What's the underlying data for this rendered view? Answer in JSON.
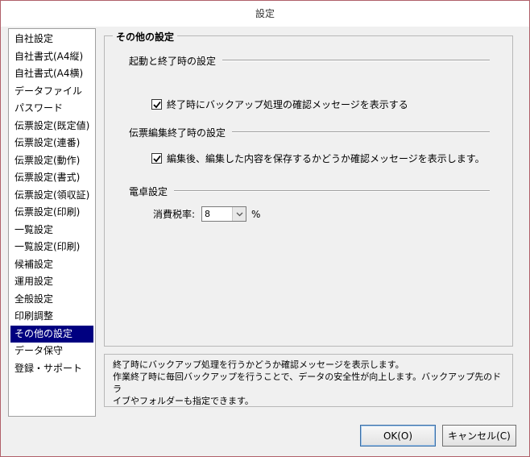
{
  "window": {
    "title": "設定"
  },
  "sidebar": {
    "items": [
      {
        "label": "自社設定",
        "selected": false
      },
      {
        "label": "自社書式(A4縦)",
        "selected": false
      },
      {
        "label": "自社書式(A4横)",
        "selected": false
      },
      {
        "label": "データファイル",
        "selected": false
      },
      {
        "label": "パスワード",
        "selected": false
      },
      {
        "label": "伝票設定(既定値)",
        "selected": false
      },
      {
        "label": "伝票設定(連番)",
        "selected": false
      },
      {
        "label": "伝票設定(動作)",
        "selected": false
      },
      {
        "label": "伝票設定(書式)",
        "selected": false
      },
      {
        "label": "伝票設定(領収証)",
        "selected": false
      },
      {
        "label": "伝票設定(印刷)",
        "selected": false
      },
      {
        "label": "一覧設定",
        "selected": false
      },
      {
        "label": "一覧設定(印刷)",
        "selected": false
      },
      {
        "label": "候補設定",
        "selected": false
      },
      {
        "label": "運用設定",
        "selected": false
      },
      {
        "label": "全般設定",
        "selected": false
      },
      {
        "label": "印刷調整",
        "selected": false
      },
      {
        "label": "その他の設定",
        "selected": true
      },
      {
        "label": "データ保守",
        "selected": false
      },
      {
        "label": "登録・サポート",
        "selected": false
      }
    ],
    "selected_color": "#000080"
  },
  "main": {
    "group_title": "その他の設定",
    "startup": {
      "title": "起動と終了時の設定",
      "backup_check": {
        "label": "終了時にバックアップ処理の確認メッセージを表示する",
        "checked": true
      }
    },
    "edit_end": {
      "title": "伝票編集終了時の設定",
      "save_check": {
        "label": "編集後、編集した内容を保存するかどうか確認メッセージを表示します。",
        "checked": true
      }
    },
    "calculator": {
      "title": "電卓設定",
      "tax_label": "消費税率:",
      "tax_value": "8",
      "tax_unit": "%"
    }
  },
  "description": {
    "lines": [
      "終了時にバックアップ処理を行うかどうか確認メッセージを表示します。",
      "作業終了時に毎回バックアップを行うことで、データの安全性が向上します。バックアップ先のドラ",
      "イブやフォルダーも指定できます。"
    ]
  },
  "buttons": {
    "ok_label": "OK(O)",
    "cancel_label": "キャンセル(C)"
  }
}
